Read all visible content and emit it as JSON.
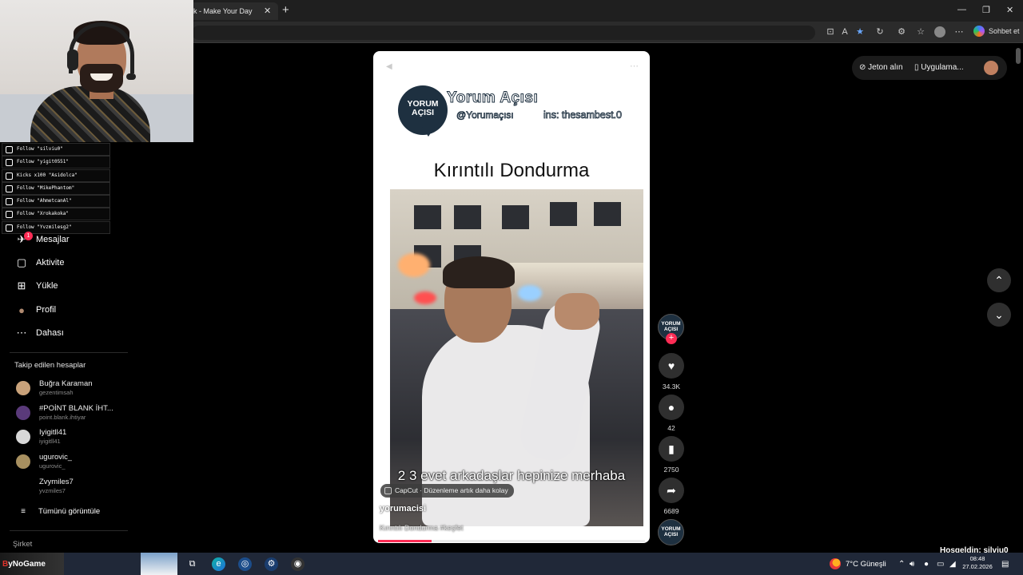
{
  "browser": {
    "tab_title": "k - Make Your Day",
    "tab_close": "✕",
    "new_tab": "+",
    "copilot_label": "Sohbet et",
    "window_controls": [
      "—",
      "❐",
      "✕"
    ]
  },
  "alerts": [
    "Follow \"silviu0\"",
    "Follow \"yigit0551\"",
    "Kicks x100 \"Asidolca\"",
    "Follow \"MikePhantom\"",
    "Follow \"AhmetcanAl\"",
    "Follow \"Xrokakoka\"",
    "Follow \"Yvzmilesg2\""
  ],
  "sidebar": {
    "messages_badge": "1",
    "items": [
      {
        "icon": "paper-plane-icon",
        "glyph": "✈",
        "label": "Mesajlar"
      },
      {
        "icon": "activity-icon",
        "glyph": "▢",
        "label": "Aktivite"
      },
      {
        "icon": "upload-icon",
        "glyph": "⊞",
        "label": "Yükle"
      },
      {
        "icon": "profile-icon",
        "glyph": "●",
        "label": "Profil"
      },
      {
        "icon": "more-icon",
        "glyph": "⋯",
        "label": "Dahası"
      }
    ],
    "following_title": "Takip edilen hesaplar",
    "accounts": [
      {
        "name": "Buğra Karaman",
        "handle": "gezentimsah",
        "color": "#c9a27a"
      },
      {
        "name": "#POİNT BLANK İHT...",
        "handle": "point.blank.ihtiyar",
        "color": "#5a3a7a"
      },
      {
        "name": "Iyigitll41",
        "handle": "iyigitll41",
        "color": "#d8d8d8"
      },
      {
        "name": "ugurovic_",
        "handle": "ugurovic_",
        "color": "#a89060"
      },
      {
        "name": "Zvymiles7",
        "handle": "yvzmiles7",
        "color": "#000000"
      }
    ],
    "see_all": "Tümünü görüntüle",
    "company": "Şirket"
  },
  "video": {
    "brand_logo_text": "YORUM AÇISI",
    "brand_title": "Yorum Açısı",
    "brand_handle": "@Yorumaçısı",
    "brand_ins": "ins: thesambest.0",
    "heading": "Kırıntılı Dondurma",
    "caption": "2 3 evet arkadaşlar hepinize merhaba",
    "capcut_label": "CapCut · Düzenleme artık daha kolay",
    "author": "yorumacisi",
    "description": "Kırıntılı Dondurma #keşfet",
    "progress_fraction": 0.2,
    "top_left_icon": "◀",
    "top_right_icon": "⋯"
  },
  "actions": {
    "avatar_text": "YORUM AÇISI",
    "follow": "+",
    "likes": "34.3K",
    "comments": "42",
    "saves": "2750",
    "shares": "6689"
  },
  "top_right": {
    "coins": "Jeton alın",
    "app": "Uygulama..."
  },
  "nav": {
    "up": "⌃",
    "down": "⌄"
  },
  "welcome": "Hoşgeldin: silviu0",
  "taskbar": {
    "brand_prefix": "B",
    "brand_rest": "yNoGame",
    "weather": "7°C  Güneşli",
    "time": "08:48",
    "date": "27.02.2026"
  },
  "colors": {
    "accent": "#fe2c55",
    "brand_navy": "#1e3040"
  }
}
